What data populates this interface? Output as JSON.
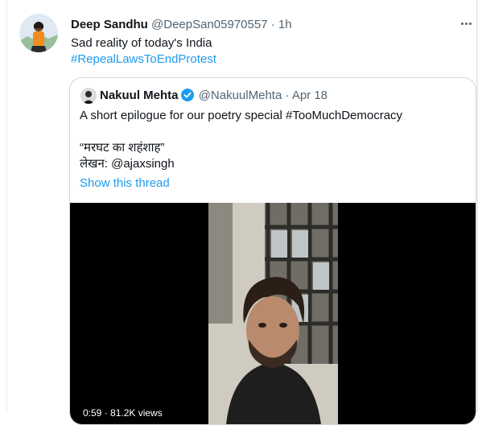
{
  "tweet": {
    "display_name": "Deep Sandhu",
    "handle": "@DeepSan05970557",
    "separator": "·",
    "time": "1h",
    "text": "Sad reality of today's India",
    "hashtag": "#RepealLawsToEndProtest",
    "more_icon": "more-options-icon"
  },
  "quote": {
    "display_name": "Nakuul Mehta",
    "handle": "@NakuulMehta",
    "separator": "·",
    "date": "Apr 18",
    "text": "A short epilogue for our poetry special #TooMuchDemocracy",
    "line2": "“मरघट का शहंशाह”",
    "line3": "लेखन: @ajaxsingh",
    "show_thread": "Show this thread",
    "verified_icon": "verified-badge-icon",
    "video_meta": "0:59 · 81.2K views"
  },
  "colors": {
    "link": "#1d9bf0",
    "muted": "#536471",
    "border": "#cfd9de"
  }
}
